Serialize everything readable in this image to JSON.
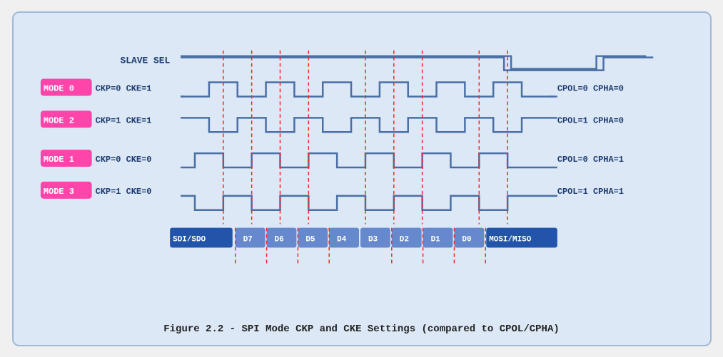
{
  "caption": "Figure 2.2 - SPI Mode CKP and CKE Settings (compared to CPOL/CPHA)",
  "diagram": {
    "slave_sel_label": "SLAVE SEL",
    "modes": [
      {
        "label": "MODE 0",
        "params": "CKP=0  CKE=1",
        "right": "CPOL=0  CPHA=0"
      },
      {
        "label": "MODE 2",
        "params": "CKP=1  CKE=1",
        "right": "CPOL=1  CPHA=0"
      },
      {
        "label": "MODE 1",
        "params": "CKP=0  CKE=0",
        "right": "CPOL=0  CPHA=1"
      },
      {
        "label": "MODE 3",
        "params": "CKP=1  CKE=0",
        "right": "CPOL=1  CPHA=1"
      }
    ],
    "data_labels": [
      "SDI/SDO",
      "D7",
      "D6",
      "D5",
      "D4",
      "D3",
      "D2",
      "D1",
      "D0",
      "MOSI/MISO"
    ]
  }
}
